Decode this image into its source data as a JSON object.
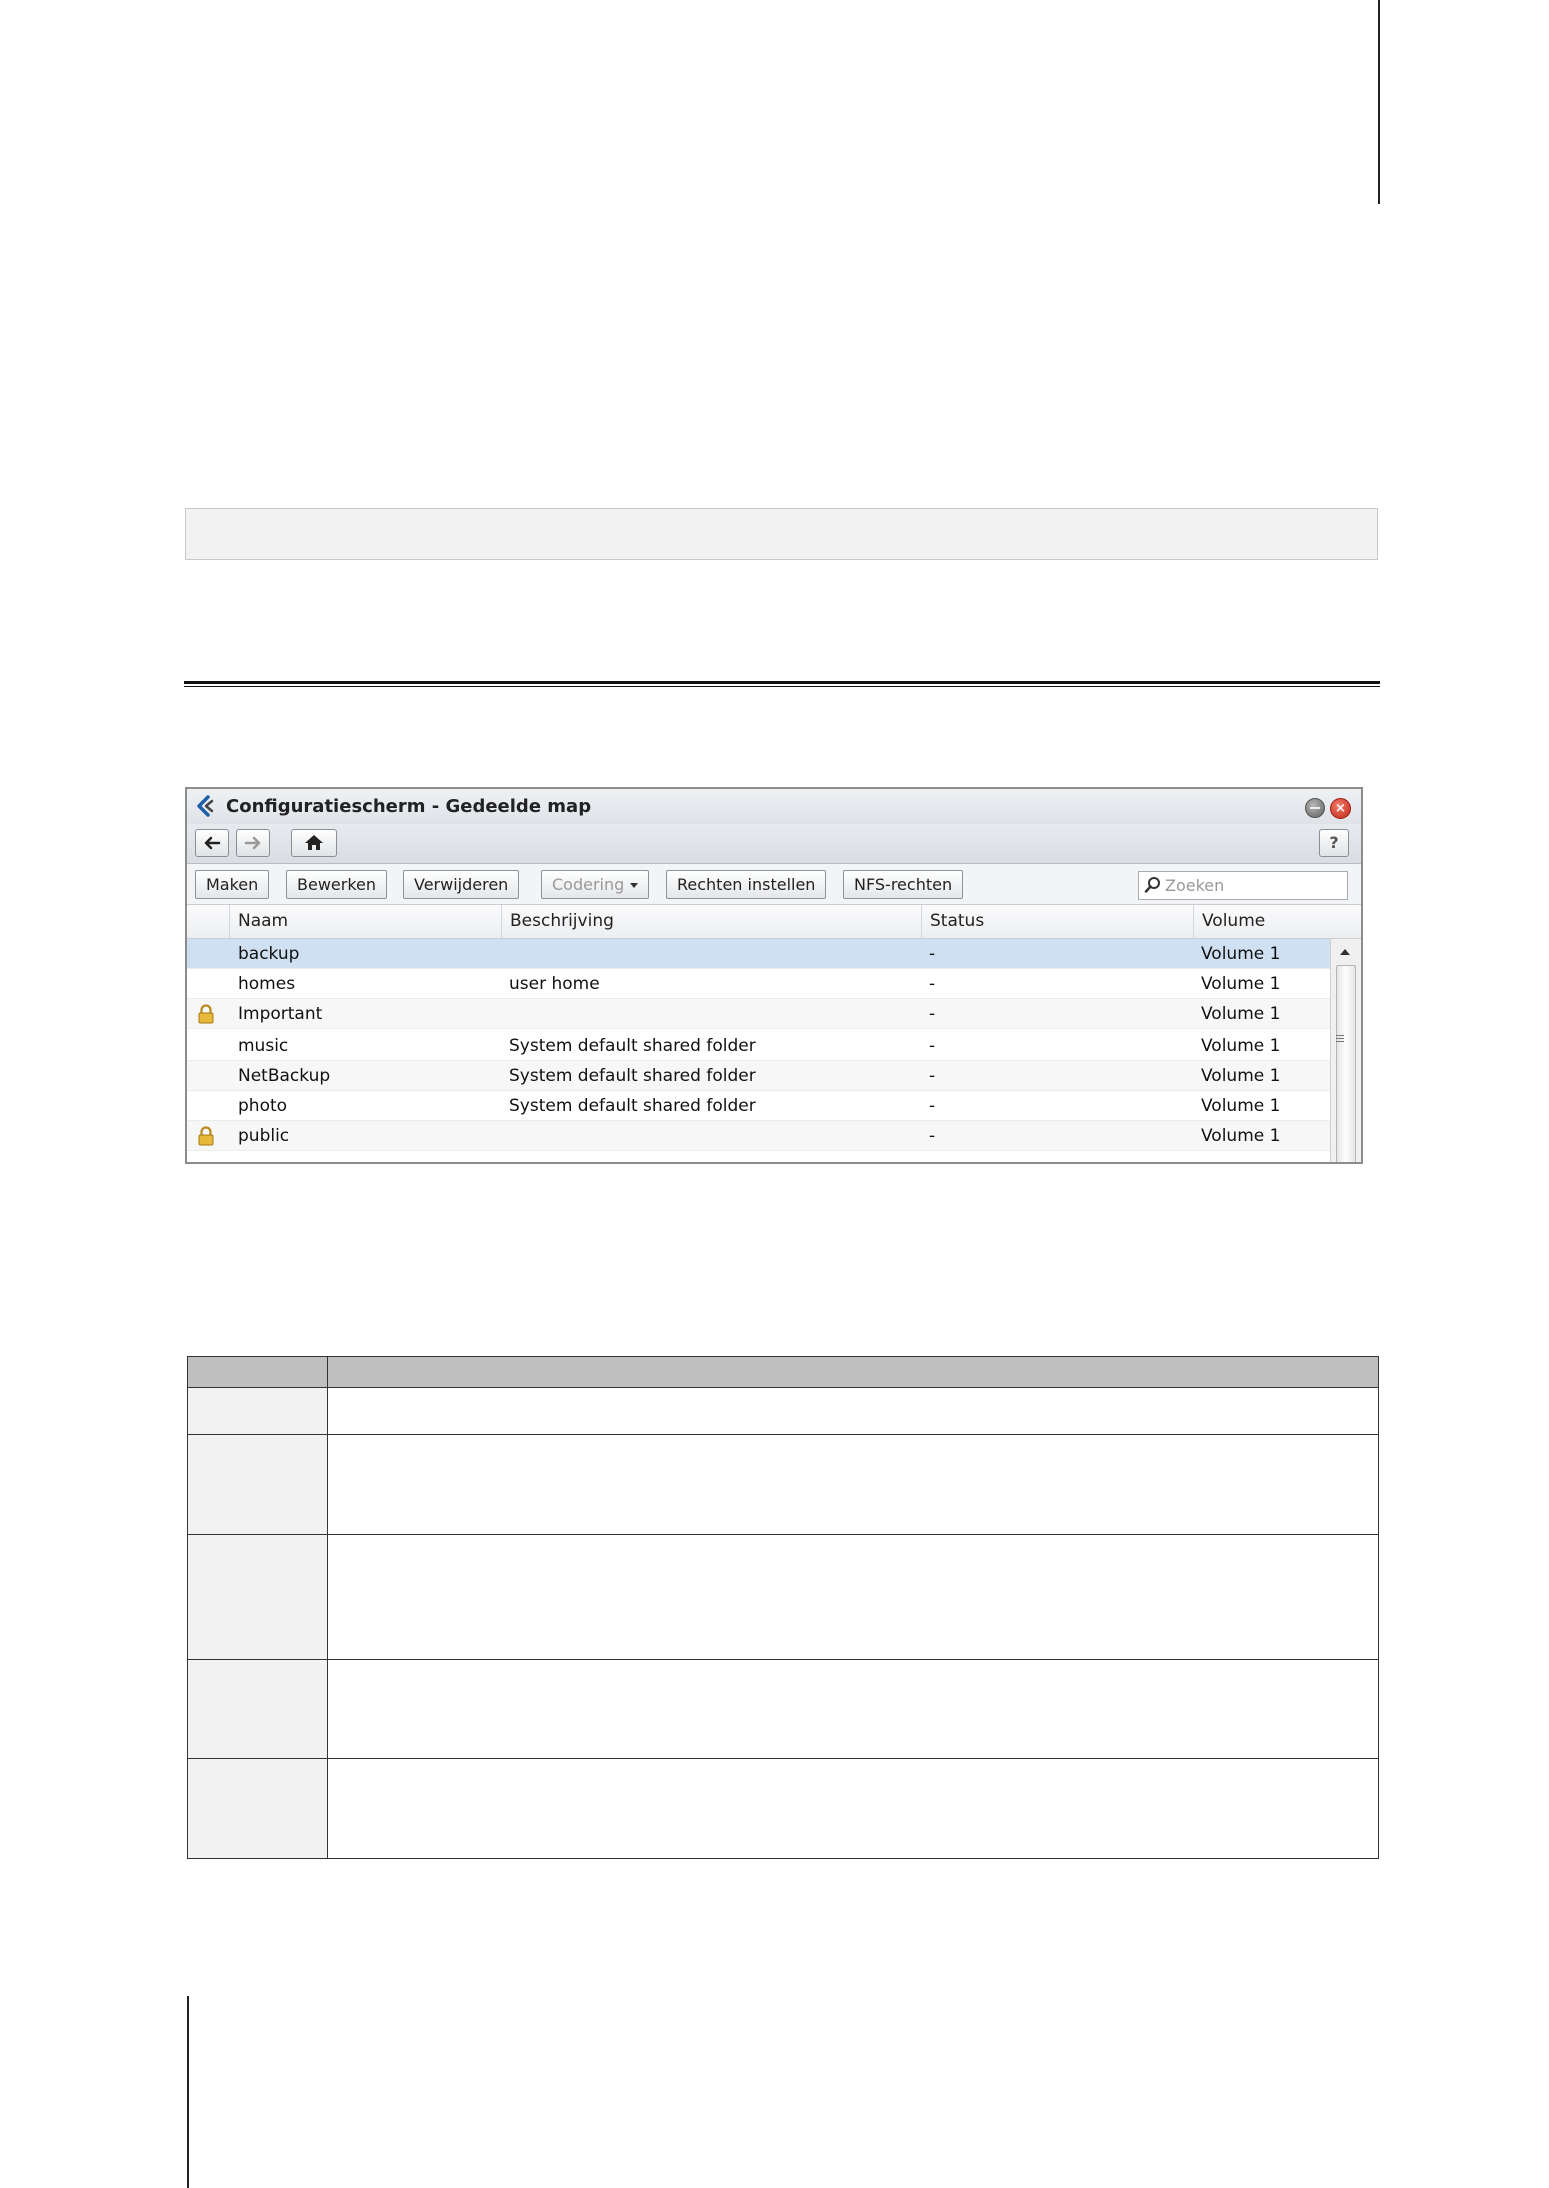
{
  "window": {
    "title": "Configuratiescherm - Gedeelde map",
    "help_label": "?"
  },
  "toolbar": {
    "create_label": "Maken",
    "edit_label": "Bewerken",
    "delete_label": "Verwijderen",
    "encoding_label": "Codering",
    "set_permissions_label": "Rechten instellen",
    "nfs_permissions_label": "NFS-rechten",
    "search_placeholder": "Zoeken"
  },
  "grid": {
    "columns": {
      "name": "Naam",
      "description": "Beschrijving",
      "status": "Status",
      "volume": "Volume"
    },
    "rows": [
      {
        "name": "backup",
        "description": "",
        "status": "-",
        "volume": "Volume 1",
        "locked": false,
        "selected": true
      },
      {
        "name": "homes",
        "description": "user home",
        "status": "-",
        "volume": "Volume 1",
        "locked": false,
        "selected": false
      },
      {
        "name": "Important",
        "description": "",
        "status": "-",
        "volume": "Volume 1",
        "locked": true,
        "selected": false
      },
      {
        "name": "music",
        "description": "System default shared folder",
        "status": "-",
        "volume": "Volume 1",
        "locked": false,
        "selected": false
      },
      {
        "name": "NetBackup",
        "description": "System default shared folder",
        "status": "-",
        "volume": "Volume 1",
        "locked": false,
        "selected": false
      },
      {
        "name": "photo",
        "description": "System default shared folder",
        "status": "-",
        "volume": "Volume 1",
        "locked": false,
        "selected": false
      },
      {
        "name": "public",
        "description": "",
        "status": "-",
        "volume": "Volume 1",
        "locked": true,
        "selected": false
      }
    ]
  },
  "colors": {
    "selected_row": "#cfe0f3",
    "close_button": "#c22a1a",
    "table_header": "#bfbfbf"
  }
}
